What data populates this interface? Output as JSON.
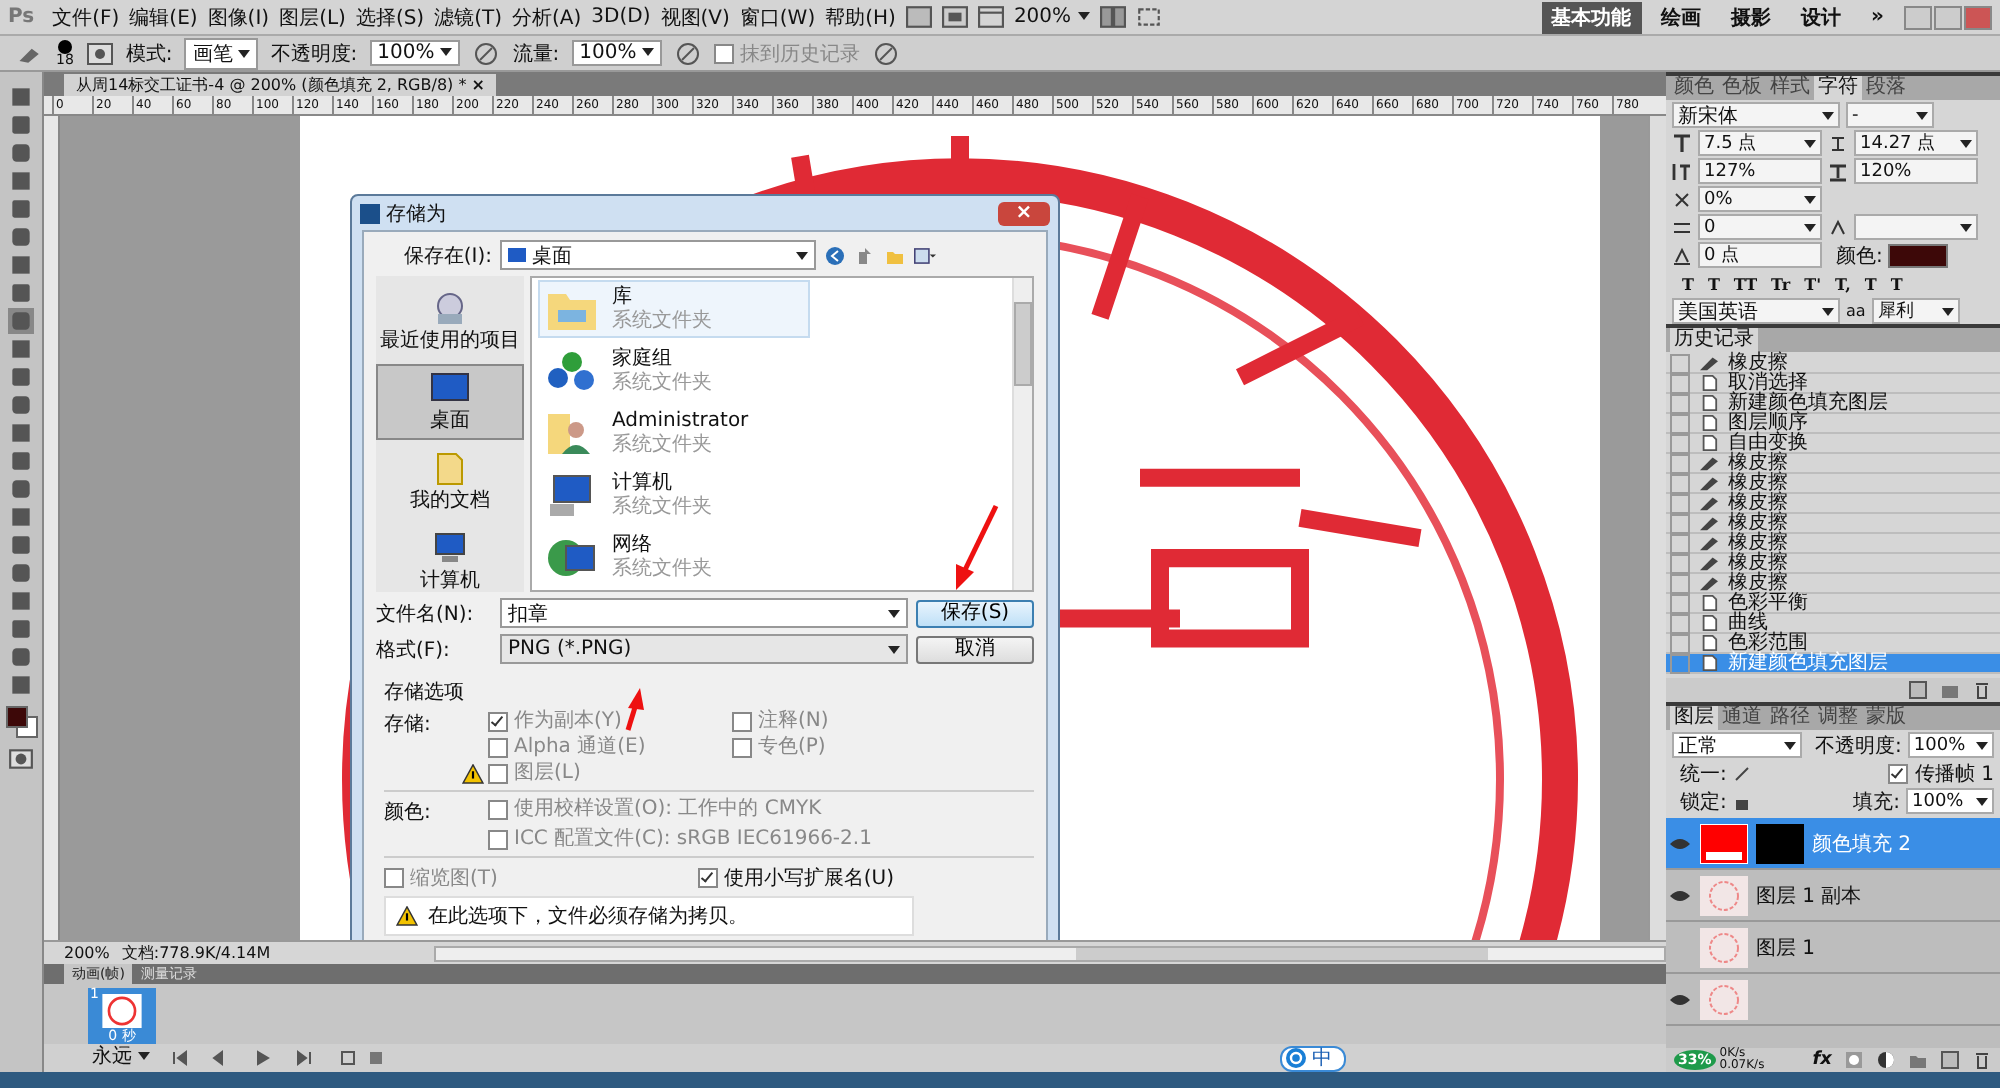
{
  "app_bar": {
    "logo": "Ps",
    "menus": [
      "文件(F)",
      "编辑(E)",
      "图像(I)",
      "图层(L)",
      "选择(S)",
      "滤镜(T)",
      "分析(A)",
      "3D(D)",
      "视图(V)",
      "窗口(W)",
      "帮助(H)"
    ],
    "zoom": "200%",
    "workspaces": [
      {
        "label": "基本功能",
        "selected": true
      },
      {
        "label": "绘画",
        "selected": false
      },
      {
        "label": "摄影",
        "selected": false
      },
      {
        "label": "设计",
        "selected": false
      }
    ],
    "more": "»"
  },
  "options_bar": {
    "brush_size": "18",
    "mode_label": "模式:",
    "mode": "画笔",
    "opacity_label": "不透明度:",
    "opacity": "100%",
    "flow_label": "流量:",
    "flow": "100%",
    "erase_history": {
      "label": "抹到历史记录",
      "checked": false,
      "disabled": true
    }
  },
  "document": {
    "tab_title": "从周14标交工证书-4 @ 200% (颜色填充 2, RGB/8) *",
    "close": "×",
    "ruler": [
      "0",
      "20",
      "40",
      "60",
      "80",
      "100",
      "120",
      "140",
      "160",
      "180",
      "200",
      "220",
      "240",
      "260",
      "280",
      "300",
      "320",
      "340",
      "360",
      "380",
      "400",
      "420",
      "440",
      "460",
      "480",
      "500",
      "520",
      "540",
      "560",
      "580",
      "600",
      "620",
      "640",
      "660",
      "680",
      "700",
      "720",
      "740",
      "760",
      "780"
    ],
    "zoom": "200%",
    "doc_size": "文档:778.9K/4.14M"
  },
  "save_dialog": {
    "title": "存储为",
    "close": "×",
    "save_in_label": "保存在(I):",
    "save_in": "桌面",
    "places": [
      {
        "label": "最近使用的项目",
        "kind": "recent",
        "selected": false
      },
      {
        "label": "桌面",
        "kind": "desktop",
        "selected": true
      },
      {
        "label": "我的文档",
        "kind": "documents",
        "selected": false
      },
      {
        "label": "计算机",
        "kind": "computer",
        "selected": false
      }
    ],
    "files": [
      {
        "name": "库",
        "type": "系统文件夹",
        "kind": "library",
        "selected": true
      },
      {
        "name": "家庭组",
        "type": "系统文件夹",
        "kind": "homegroup",
        "selected": false
      },
      {
        "name": "Administrator",
        "type": "系统文件夹",
        "kind": "user",
        "selected": false
      },
      {
        "name": "计算机",
        "type": "系统文件夹",
        "kind": "computer",
        "selected": false
      },
      {
        "name": "网络",
        "type": "系统文件夹",
        "kind": "network",
        "selected": false
      }
    ],
    "filename_label": "文件名(N):",
    "filename": "扣章",
    "format_label": "格式(F):",
    "format": "PNG (*.PNG)",
    "save_button": "保存(S)",
    "cancel_button": "取消",
    "options_title": "存储选项",
    "save_label": "存储:",
    "save_options": [
      {
        "label": "作为副本(Y)",
        "checked": true,
        "disabled": true,
        "warning": false
      },
      {
        "label": "注释(N)",
        "checked": false,
        "disabled": true,
        "warning": false
      },
      {
        "label": "Alpha 通道(E)",
        "checked": false,
        "disabled": true,
        "warning": false
      },
      {
        "label": "专色(P)",
        "checked": false,
        "disabled": true,
        "warning": false
      },
      {
        "label": "图层(L)",
        "checked": false,
        "disabled": true,
        "warning": true
      }
    ],
    "color_label": "颜色:",
    "color_options": [
      {
        "label": "使用校样设置(O): 工作中的 CMYK",
        "checked": false,
        "disabled": true
      },
      {
        "label": "ICC 配置文件(C): sRGB IEC61966-2.1",
        "checked": false,
        "disabled": true
      }
    ],
    "thumbnail": {
      "label": "缩览图(T)",
      "checked": false,
      "disabled": true
    },
    "lowercase": {
      "label": "使用小写扩展名(U)",
      "checked": true,
      "disabled": false
    },
    "warning": "在此选项下，文件必须存储为拷贝。"
  },
  "character_panel": {
    "tabs": [
      {
        "label": "颜色",
        "selected": false
      },
      {
        "label": "色板",
        "selected": false
      },
      {
        "label": "样式",
        "selected": false
      },
      {
        "label": "字符",
        "selected": true
      },
      {
        "label": "段落",
        "selected": false
      }
    ],
    "font": "新宋体",
    "style": "-",
    "size": "7.5 点",
    "leading": "14.27 点",
    "vertical_scale": "127%",
    "horizontal_scale": "120%",
    "tsume": "0%",
    "tracking": "0",
    "baseline": "0 点",
    "color_label": "颜色:",
    "color": "#3d0808",
    "style_buttons": [
      "T",
      "T",
      "TT",
      "Tr",
      "T'",
      "T,",
      "T",
      "T"
    ],
    "language": "美国英语",
    "antialias_icon": "aa",
    "antialias": "犀利"
  },
  "history_panel": {
    "title": "历史记录",
    "items": [
      {
        "label": "橡皮擦",
        "kind": "eraser",
        "selected": false
      },
      {
        "label": "取消选择",
        "kind": "step",
        "selected": false
      },
      {
        "label": "新建颜色填充图层",
        "kind": "step",
        "selected": false
      },
      {
        "label": "图层顺序",
        "kind": "step",
        "selected": false
      },
      {
        "label": "自由变换",
        "kind": "step",
        "selected": false
      },
      {
        "label": "橡皮擦",
        "kind": "eraser",
        "selected": false
      },
      {
        "label": "橡皮擦",
        "kind": "eraser",
        "selected": false
      },
      {
        "label": "橡皮擦",
        "kind": "eraser",
        "selected": false
      },
      {
        "label": "橡皮擦",
        "kind": "eraser",
        "selected": false
      },
      {
        "label": "橡皮擦",
        "kind": "eraser",
        "selected": false
      },
      {
        "label": "橡皮擦",
        "kind": "eraser",
        "selected": false
      },
      {
        "label": "橡皮擦",
        "kind": "eraser",
        "selected": false
      },
      {
        "label": "色彩平衡",
        "kind": "step",
        "selected": false
      },
      {
        "label": "曲线",
        "kind": "step",
        "selected": false
      },
      {
        "label": "色彩范围",
        "kind": "step",
        "selected": false
      },
      {
        "label": "新建颜色填充图层",
        "kind": "step",
        "selected": true
      }
    ]
  },
  "layers_panel": {
    "tabs": [
      {
        "label": "图层",
        "selected": true
      },
      {
        "label": "通道",
        "selected": false
      },
      {
        "label": "路径",
        "selected": false
      },
      {
        "label": "调整",
        "selected": false
      },
      {
        "label": "蒙版",
        "selected": false
      }
    ],
    "blend_mode": "正常",
    "opacity_label": "不透明度:",
    "opacity": "100%",
    "unify_label": "统一:",
    "propagate": {
      "label": "传播帧 1",
      "checked": true
    },
    "lock_label": "锁定:",
    "fill_label": "填充:",
    "fill": "100%",
    "layer_style": "fx",
    "layers": [
      {
        "name": "颜色填充 2",
        "kind": "fill",
        "visible": true,
        "selected": true
      },
      {
        "name": "图层 1 副本",
        "kind": "pixels",
        "visible": true,
        "selected": false
      },
      {
        "name": "图层 1",
        "kind": "pixels",
        "visible": false,
        "selected": false
      },
      {
        "kind": "pixels",
        "visible": true,
        "selected": false
      }
    ]
  },
  "animation_panel": {
    "tabs": [
      {
        "label": "动画(帧)",
        "selected": true
      },
      {
        "label": "测量记录",
        "selected": false
      }
    ],
    "frame_number": "1",
    "frame_delay": "0 秒",
    "loop": "永远"
  },
  "tray": {
    "ime": "中",
    "speed_percent": "33%",
    "upload": "0K/s",
    "download": "0.07K/s"
  }
}
